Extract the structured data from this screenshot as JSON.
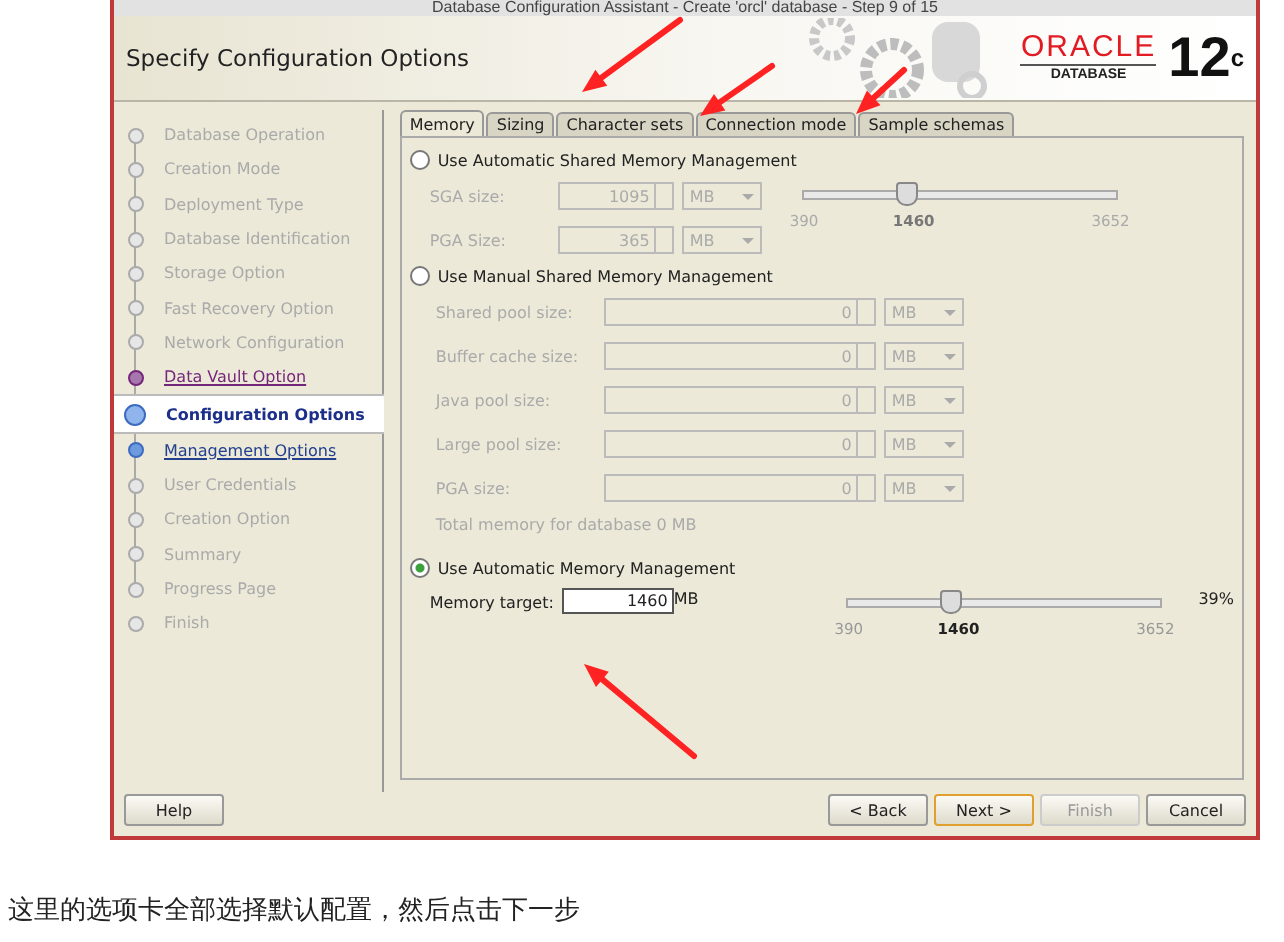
{
  "window": {
    "title": "Database Configuration Assistant - Create 'orcl' database - Step 9 of 15"
  },
  "header": {
    "title": "Specify Configuration Options",
    "brand": "ORACLE",
    "product": "DATABASE",
    "version": "12",
    "version_suffix": "c"
  },
  "steps": [
    {
      "label": "Database Operation",
      "kind": "plain",
      "selected": false
    },
    {
      "label": "Creation Mode",
      "kind": "plain",
      "selected": false
    },
    {
      "label": "Deployment Type",
      "kind": "plain",
      "selected": false
    },
    {
      "label": "Database Identification",
      "kind": "plain",
      "selected": false
    },
    {
      "label": "Storage Option",
      "kind": "plain",
      "selected": false
    },
    {
      "label": "Fast Recovery Option",
      "kind": "plain",
      "selected": false
    },
    {
      "label": "Network Configuration",
      "kind": "plain",
      "selected": false
    },
    {
      "label": "Data Vault Option",
      "kind": "visited",
      "selected": false
    },
    {
      "label": "Configuration Options",
      "kind": "plain",
      "selected": true
    },
    {
      "label": "Management Options",
      "kind": "link",
      "selected": false
    },
    {
      "label": "User Credentials",
      "kind": "plain",
      "selected": false
    },
    {
      "label": "Creation Option",
      "kind": "plain",
      "selected": false
    },
    {
      "label": "Summary",
      "kind": "plain",
      "selected": false
    },
    {
      "label": "Progress Page",
      "kind": "plain",
      "selected": false
    },
    {
      "label": "Finish",
      "kind": "plain",
      "selected": false
    }
  ],
  "tabs": [
    {
      "label": "Memory",
      "selected": true
    },
    {
      "label": "Sizing",
      "selected": false
    },
    {
      "label": "Character sets",
      "selected": false
    },
    {
      "label": "Connection mode",
      "selected": false
    },
    {
      "label": "Sample schemas",
      "selected": false
    }
  ],
  "options": [
    {
      "kind": "automatic_shared",
      "label": "Use Automatic Shared Memory Management",
      "selected": false,
      "fields": [
        {
          "label": "SGA size:",
          "value": "1095",
          "unit": "MB"
        },
        {
          "label": "PGA Size:",
          "value": "365",
          "unit": "MB"
        }
      ],
      "slider": {
        "level": 0.328,
        "min": "390",
        "value": "1460",
        "max": "3652"
      }
    },
    {
      "kind": "manual_shared",
      "label": "Use Manual Shared Memory Management",
      "selected": false,
      "fields": [
        {
          "label": "Shared pool size:",
          "value": "0",
          "unit": "MB"
        },
        {
          "label": "Buffer cache size:",
          "value": "0",
          "unit": "MB"
        },
        {
          "label": "Java pool size:",
          "value": "0",
          "unit": "MB"
        },
        {
          "label": "Large pool size:",
          "value": "0",
          "unit": "MB"
        },
        {
          "label": "PGA size:",
          "value": "0",
          "unit": "MB"
        }
      ],
      "total": "Total memory for database 0 MB"
    },
    {
      "kind": "automatic",
      "label": "Use Automatic Memory Management",
      "selected": true,
      "target": {
        "label": "Memory target:",
        "value": "1460",
        "unit": "MB"
      },
      "slider": {
        "level": 0.328,
        "min": "390",
        "value": "1460",
        "max": "3652"
      },
      "percent": "39%"
    }
  ],
  "buttons": [
    {
      "label": "Help",
      "kind": "plain",
      "disabled": false
    },
    {
      "label": "< Back",
      "kind": "plain",
      "disabled": false
    },
    {
      "label": "Next >",
      "kind": "default",
      "disabled": false
    },
    {
      "label": "Finish",
      "kind": "plain",
      "disabled": true
    },
    {
      "label": "Cancel",
      "kind": "plain",
      "disabled": false
    }
  ],
  "caption": "这里的选项卡全部选择默认配置，然后点击下一步"
}
